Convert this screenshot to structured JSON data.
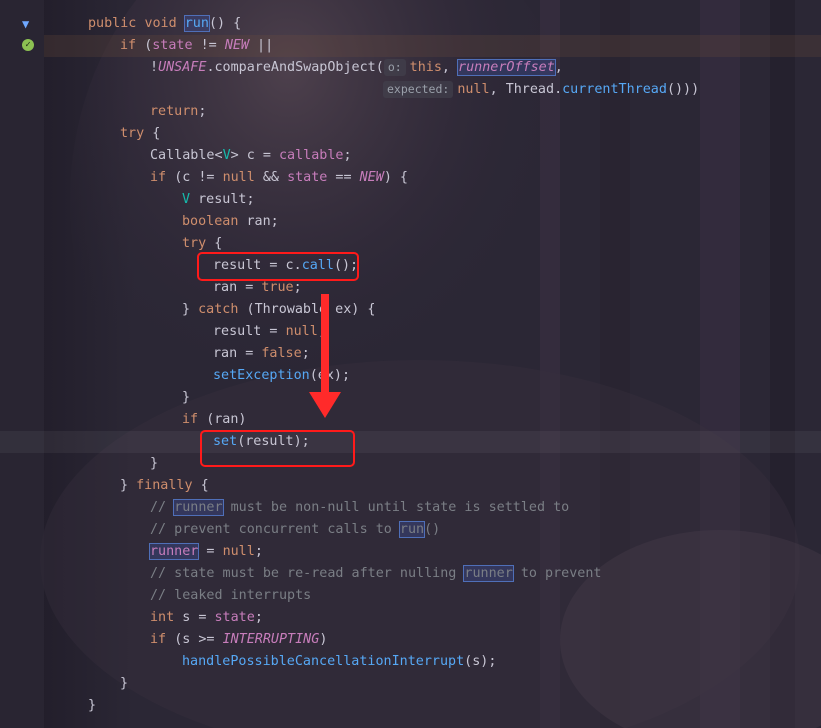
{
  "editor": {
    "lines": [
      [
        {
          "t": "public ",
          "c": "kw"
        },
        {
          "t": "void ",
          "c": "kw"
        },
        {
          "t": "run",
          "c": "fn box"
        },
        {
          "t": "() {",
          "c": ""
        }
      ],
      [
        {
          "t": "if ",
          "c": "kw"
        },
        {
          "t": "(",
          "c": ""
        },
        {
          "t": "state",
          "c": "fld"
        },
        {
          "t": " != ",
          "c": ""
        },
        {
          "t": "NEW",
          "c": "st"
        },
        {
          "t": " ||",
          "c": ""
        }
      ],
      [
        {
          "t": "!",
          "c": ""
        },
        {
          "t": "UNSAFE",
          "c": "st"
        },
        {
          "t": ".compareAndSwapObject(",
          "c": ""
        },
        {
          "t": "o:",
          "c": "hint"
        },
        {
          "t": "this",
          "c": "kw"
        },
        {
          "t": ", ",
          "c": ""
        },
        {
          "t": "runnerOffset",
          "c": "st box"
        },
        {
          "t": ",",
          "c": ""
        }
      ],
      [
        {
          "t": "expected:",
          "c": "hint"
        },
        {
          "t": "null",
          "c": "kw"
        },
        {
          "t": ", ",
          "c": ""
        },
        {
          "t": "Thread",
          "c": "cls"
        },
        {
          "t": ".",
          "c": ""
        },
        {
          "t": "currentThread",
          "c": "fn"
        },
        {
          "t": "()))",
          "c": ""
        }
      ],
      [
        {
          "t": "return",
          "c": "kw"
        },
        {
          "t": ";",
          "c": ""
        }
      ],
      [
        {
          "t": "try ",
          "c": "kw"
        },
        {
          "t": "{",
          "c": ""
        }
      ],
      [
        {
          "t": "Callable",
          "c": "cls"
        },
        {
          "t": "<",
          "c": ""
        },
        {
          "t": "V",
          "c": "gen"
        },
        {
          "t": "> c = ",
          "c": ""
        },
        {
          "t": "callable",
          "c": "fld"
        },
        {
          "t": ";",
          "c": ""
        }
      ],
      [
        {
          "t": "if ",
          "c": "kw"
        },
        {
          "t": "(c != ",
          "c": ""
        },
        {
          "t": "null",
          "c": "kw"
        },
        {
          "t": " && ",
          "c": ""
        },
        {
          "t": "state",
          "c": "fld"
        },
        {
          "t": " == ",
          "c": ""
        },
        {
          "t": "NEW",
          "c": "st"
        },
        {
          "t": ") {",
          "c": ""
        }
      ],
      [
        {
          "t": "V",
          "c": "gen"
        },
        {
          "t": " result;",
          "c": ""
        }
      ],
      [
        {
          "t": "boolean ",
          "c": "kw"
        },
        {
          "t": "ran;",
          "c": ""
        }
      ],
      [
        {
          "t": "try ",
          "c": "kw"
        },
        {
          "t": "{",
          "c": ""
        }
      ],
      [
        {
          "t": "result = c.",
          "c": ""
        },
        {
          "t": "call",
          "c": "fn"
        },
        {
          "t": "();",
          "c": ""
        }
      ],
      [
        {
          "t": "ran = ",
          "c": ""
        },
        {
          "t": "true",
          "c": "kw"
        },
        {
          "t": ";",
          "c": ""
        }
      ],
      [
        {
          "t": "} ",
          "c": ""
        },
        {
          "t": "catch ",
          "c": "kw"
        },
        {
          "t": "(",
          "c": ""
        },
        {
          "t": "Throwable",
          "c": "cls"
        },
        {
          "t": " ex) {",
          "c": ""
        }
      ],
      [
        {
          "t": "result = ",
          "c": ""
        },
        {
          "t": "null",
          "c": "kw"
        },
        {
          "t": ";",
          "c": ""
        }
      ],
      [
        {
          "t": "ran = ",
          "c": ""
        },
        {
          "t": "false",
          "c": "kw"
        },
        {
          "t": ";",
          "c": ""
        }
      ],
      [
        {
          "t": "setException",
          "c": "fn"
        },
        {
          "t": "(ex);",
          "c": ""
        }
      ],
      [
        {
          "t": "}",
          "c": ""
        }
      ],
      [
        {
          "t": "if ",
          "c": "kw"
        },
        {
          "t": "(ran)",
          "c": ""
        }
      ],
      [
        {
          "t": "set",
          "c": "fn"
        },
        {
          "t": "(result);",
          "c": ""
        }
      ],
      [
        {
          "t": "}",
          "c": ""
        }
      ],
      [
        {
          "t": "} ",
          "c": ""
        },
        {
          "t": "finally ",
          "c": "kw"
        },
        {
          "t": "{",
          "c": ""
        }
      ],
      [
        {
          "t": "// ",
          "c": "cm"
        },
        {
          "t": "runner",
          "c": "cm box"
        },
        {
          "t": " must be non-null until state is settled to",
          "c": "cm"
        }
      ],
      [
        {
          "t": "// prevent concurrent calls to ",
          "c": "cm"
        },
        {
          "t": "run",
          "c": "cm box"
        },
        {
          "t": "()",
          "c": "cm"
        }
      ],
      [
        {
          "t": "runner",
          "c": "fld box"
        },
        {
          "t": " = ",
          "c": ""
        },
        {
          "t": "null",
          "c": "kw"
        },
        {
          "t": ";",
          "c": ""
        }
      ],
      [
        {
          "t": "// state must be re-read after nulling ",
          "c": "cm"
        },
        {
          "t": "runner",
          "c": "cm box"
        },
        {
          "t": " to prevent",
          "c": "cm"
        }
      ],
      [
        {
          "t": "// leaked interrupts",
          "c": "cm"
        }
      ],
      [
        {
          "t": "int ",
          "c": "kw"
        },
        {
          "t": "s = ",
          "c": ""
        },
        {
          "t": "state",
          "c": "fld"
        },
        {
          "t": ";",
          "c": ""
        }
      ],
      [
        {
          "t": "if ",
          "c": "kw"
        },
        {
          "t": "(s >= ",
          "c": ""
        },
        {
          "t": "INTERRUPTING",
          "c": "st"
        },
        {
          "t": ")",
          "c": ""
        }
      ],
      [
        {
          "t": "handlePossibleCancellationInterrupt",
          "c": "fn"
        },
        {
          "t": "(s);",
          "c": ""
        }
      ],
      [
        {
          "t": "}",
          "c": ""
        }
      ],
      [
        {
          "t": "}",
          "c": ""
        }
      ]
    ]
  },
  "gutter": {
    "icons": [
      "override-down-icon",
      "check-icon"
    ]
  },
  "colors": {
    "annotation": "#ff2a2a",
    "keyword": "#cf8e6d",
    "field": "#c77dbb",
    "method": "#56a8f5",
    "comment": "#7a7e85"
  }
}
